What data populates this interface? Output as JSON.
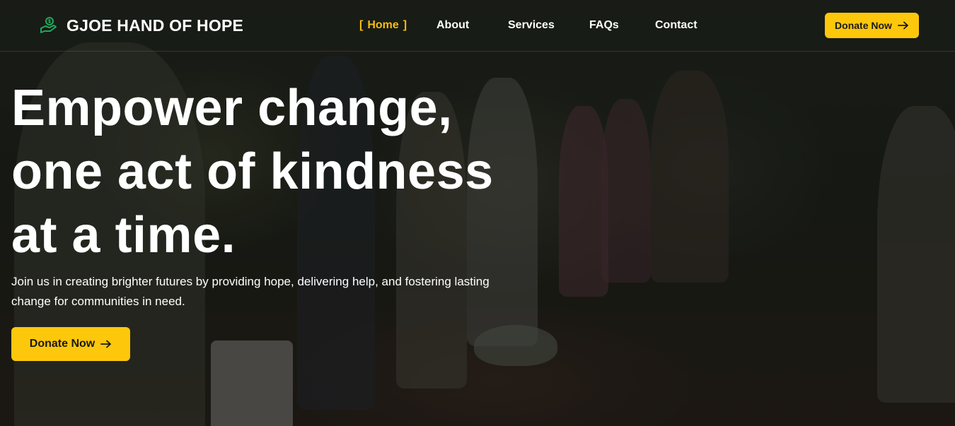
{
  "brand": {
    "name": "GJOE HAND OF HOPE",
    "icon": "money-hand-icon"
  },
  "nav": {
    "home_bracket_left": "[",
    "home": "Home",
    "home_bracket_right": "]",
    "about": "About",
    "services": "Services",
    "faqs": "FAQs",
    "contact": "Contact"
  },
  "header_cta": {
    "label": "Donate Now",
    "icon": "arrow-right-icon"
  },
  "hero": {
    "headline_lines": [
      "Empower change,",
      "one act of kindness",
      "at a time."
    ],
    "subtext": "Join us in creating brighter futures by providing hope, delivering help, and fostering lasting change for communities in need.",
    "cta_label": "Donate Now",
    "cta_icon": "arrow-right-icon",
    "background": "photo-of-children-gathering-water-in-forest"
  },
  "colors": {
    "accent": "#fdc70c",
    "active_nav": "#f5bd0f",
    "brand_icon": "#22a85a",
    "text": "#ffffff"
  }
}
